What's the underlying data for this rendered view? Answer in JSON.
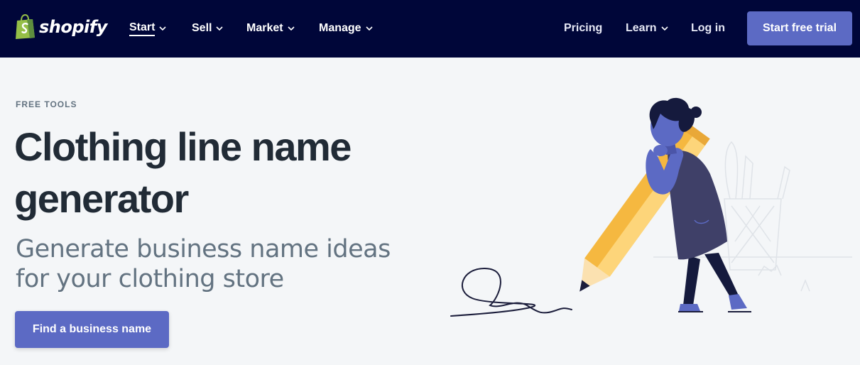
{
  "brand": {
    "name": "shopify",
    "icon": "shopping-bag-icon",
    "color": "#95bf47"
  },
  "nav": {
    "items": [
      {
        "label": "Start",
        "has_dropdown": true,
        "active": true
      },
      {
        "label": "Sell",
        "has_dropdown": true
      },
      {
        "label": "Market",
        "has_dropdown": true
      },
      {
        "label": "Manage",
        "has_dropdown": true
      }
    ],
    "right_items": [
      {
        "label": "Pricing",
        "has_dropdown": false
      },
      {
        "label": "Learn",
        "has_dropdown": true
      },
      {
        "label": "Log in",
        "has_dropdown": false
      }
    ],
    "cta_label": "Start free trial",
    "background": "#000639",
    "accent": "#5c6ac4"
  },
  "hero": {
    "eyebrow": "FREE TOOLS",
    "title": "Clothing line name generator",
    "subtitle": "Generate business name ideas for your clothing store",
    "button_label": "Find a business name",
    "illustration": "person-with-pencil-illustration"
  }
}
